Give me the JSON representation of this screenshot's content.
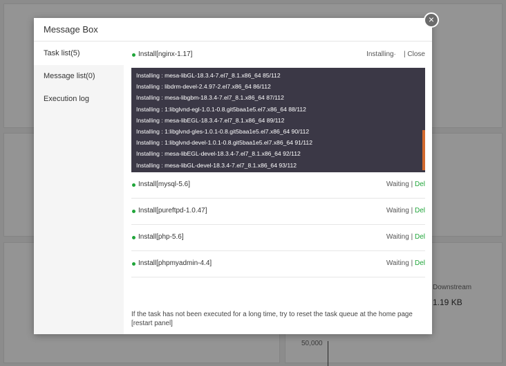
{
  "background": {
    "label_downstream": "Downstream",
    "value_downstream": "1.19 KB",
    "axis_tick": "50,000"
  },
  "modal": {
    "title": "Message Box",
    "close_glyph": "×"
  },
  "sidebar": {
    "items": [
      {
        "label": "Task list(5)"
      },
      {
        "label": "Message list(0)"
      },
      {
        "label": "Execution log"
      }
    ]
  },
  "tasks": [
    {
      "name": "Install[nginx-1.17]",
      "status": "Installing·",
      "action": "Close"
    },
    {
      "name": "Install[mysql-5.6]",
      "status": "Waiting",
      "action": "Del"
    },
    {
      "name": "Install[pureftpd-1.0.47]",
      "status": "Waiting",
      "action": "Del"
    },
    {
      "name": "Install[php-5.6]",
      "status": "Waiting",
      "action": "Del"
    },
    {
      "name": "Install[phpmyadmin-4.4]",
      "status": "Waiting",
      "action": "Del"
    }
  ],
  "log_lines": [
    "Installing : mesa-libGL-18.3.4-7.el7_8.1.x86_64 85/112",
    "Installing : libdrm-devel-2.4.97-2.el7.x86_64 86/112",
    "Installing : mesa-libgbm-18.3.4-7.el7_8.1.x86_64 87/112",
    "Installing : 1:libglvnd-egl-1.0.1-0.8.git5baa1e5.el7.x86_64 88/112",
    "Installing : mesa-libEGL-18.3.4-7.el7_8.1.x86_64 89/112",
    "Installing : 1:libglvnd-gles-1.0.1-0.8.git5baa1e5.el7.x86_64 90/112",
    "Installing : 1:libglvnd-devel-1.0.1-0.8.git5baa1e5.el7.x86_64 91/112",
    "Installing : mesa-libEGL-devel-18.3.4-7.el7_8.1.x86_64 92/112",
    "Installing : mesa-libGL-devel-18.3.4-7.el7_8.1.x86_64 93/112"
  ],
  "separator": "|",
  "tip": "If the task has not been executed for a long time, try to reset the task queue at the home page [restart panel]",
  "colors": {
    "accent_green": "#20a53a",
    "log_background": "#3b3846",
    "scroll_thumb": "#d2692e"
  }
}
